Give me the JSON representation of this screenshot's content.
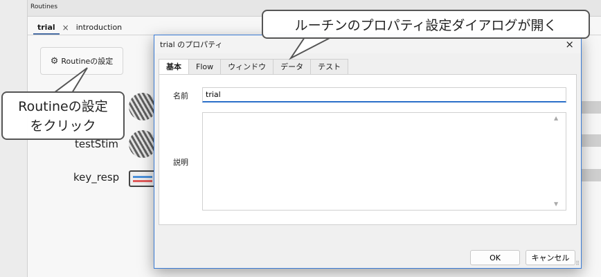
{
  "routines_label": "Routines",
  "editor_tabs": [
    {
      "label": "trial",
      "close": "×"
    },
    {
      "label": "introduction"
    }
  ],
  "routine_settings_label": "Routineの設定",
  "components": [
    "testStim",
    "key_resp"
  ],
  "dialog": {
    "title": "trial のプロパティ",
    "close": "×",
    "tabs": [
      "基本",
      "Flow",
      "ウィンドウ",
      "データ",
      "テスト"
    ],
    "name_label": "名前",
    "name_value": "trial",
    "description_label": "説明",
    "description_value": "",
    "ok_label": "OK",
    "cancel_label": "キャンセル"
  },
  "callouts": {
    "top": "ルーチンのプロパティ設定ダイアログが開く",
    "left_line1": "Routineの設定",
    "left_line2": "をクリック"
  },
  "icons": {
    "gear": "gear-icon",
    "close": "close-icon",
    "stim": "grating-stimulus-icon",
    "keyboard": "keyboard-icon"
  }
}
